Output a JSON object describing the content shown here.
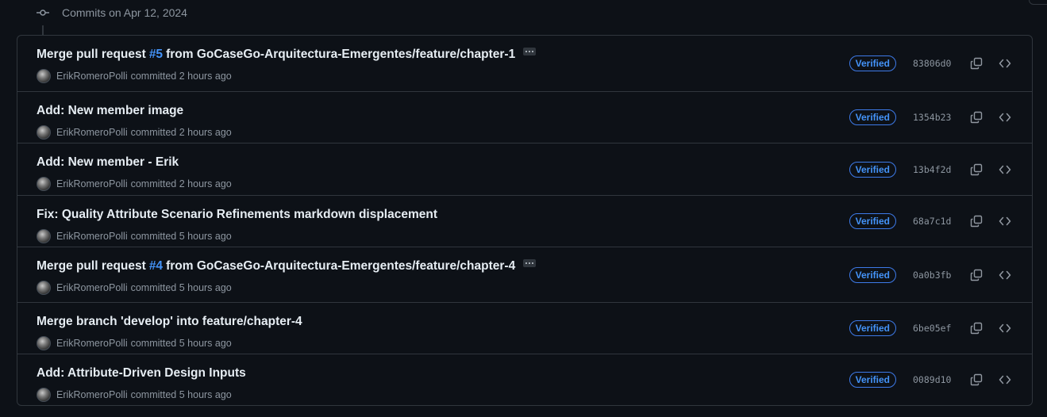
{
  "group": {
    "label": "Commits on Apr 12, 2024"
  },
  "commits": [
    {
      "title_before": "Merge pull request",
      "pr": "#5",
      "title_after": "from GoCaseGo-Arquitectura-Emergentes/feature/chapter-1",
      "has_ellipsis": true,
      "author": "ErikRomeroPolli",
      "time": "committed 2 hours ago",
      "verified": "Verified",
      "sha": "83806d0"
    },
    {
      "title_before": "Add: New member image",
      "pr": "",
      "title_after": "",
      "has_ellipsis": false,
      "author": "ErikRomeroPolli",
      "time": "committed 2 hours ago",
      "verified": "Verified",
      "sha": "1354b23"
    },
    {
      "title_before": "Add: New member - Erik",
      "pr": "",
      "title_after": "",
      "has_ellipsis": false,
      "author": "ErikRomeroPolli",
      "time": "committed 2 hours ago",
      "verified": "Verified",
      "sha": "13b4f2d"
    },
    {
      "title_before": "Fix: Quality Attribute Scenario Refinements markdown displacement",
      "pr": "",
      "title_after": "",
      "has_ellipsis": false,
      "author": "ErikRomeroPolli",
      "time": "committed 5 hours ago",
      "verified": "Verified",
      "sha": "68a7c1d"
    },
    {
      "title_before": "Merge pull request",
      "pr": "#4",
      "title_after": "from GoCaseGo-Arquitectura-Emergentes/feature/chapter-4",
      "has_ellipsis": true,
      "author": "ErikRomeroPolli",
      "time": "committed 5 hours ago",
      "verified": "Verified",
      "sha": "0a0b3fb"
    },
    {
      "title_before": "Merge branch 'develop' into feature/chapter-4",
      "pr": "",
      "title_after": "",
      "has_ellipsis": false,
      "author": "ErikRomeroPolli",
      "time": "committed 5 hours ago",
      "verified": "Verified",
      "sha": "6be05ef"
    },
    {
      "title_before": "Add: Attribute-Driven Design Inputs",
      "pr": "",
      "title_after": "",
      "has_ellipsis": false,
      "author": "ErikRomeroPolli",
      "time": "committed 5 hours ago",
      "verified": "Verified",
      "sha": "0089d10"
    }
  ],
  "icons": {
    "group": "git-commit-icon",
    "copy": "copy-icon",
    "browse": "code-icon"
  },
  "colors": {
    "background": "#0d1117",
    "border": "#30363d",
    "link": "#4493f8",
    "muted": "#8d96a0",
    "text": "#e6edf3"
  }
}
